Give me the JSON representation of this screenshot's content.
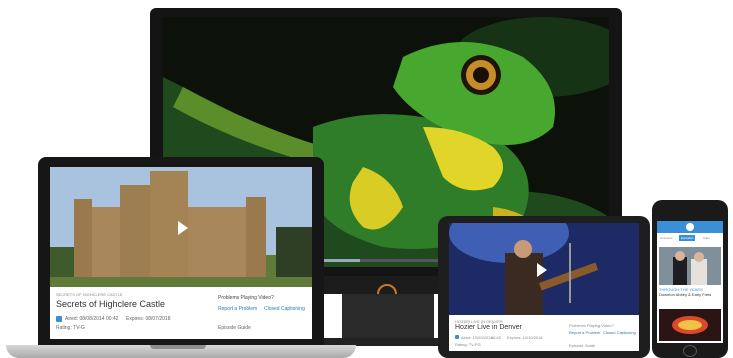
{
  "laptop": {
    "eyebrow": "SECRETS OF HIGHCLERE CASTLE",
    "title": "Secrets of Highclere Castle",
    "aired": "Aired: 08/08/2014",
    "duration": "00:42",
    "expires": "Expires: 08/07/2018",
    "rating": "Rating: TV-G",
    "problems_heading": "Problems Playing Video?",
    "report_link": "Report a Problem",
    "captions_link": "Closed Captioning",
    "episode_guide": "Episode Guide"
  },
  "tablet": {
    "eyebrow": "HOZIER LIVE IN DENVER",
    "title": "Hozier Live in Denver",
    "aired": "Aired: 10/09/2014",
    "duration": "56:42",
    "expires": "Expires: 10/10/2018",
    "rating": "Rating: TV-PG",
    "problems_heading": "Problems Playing Video?",
    "report_link": "Report a Problem",
    "captions_link": "Closed Captioning",
    "episode_guide": "Episode Guide"
  },
  "phone": {
    "tabs": [
      "Overview",
      "Episodes",
      "Clips"
    ],
    "featured_title": "Downton Abbey & Early Frets",
    "featured_sub": "THROUGH THE YEARS"
  },
  "colors": {
    "accent": "#3a8fd6",
    "power_ring": "#c77a2a"
  }
}
